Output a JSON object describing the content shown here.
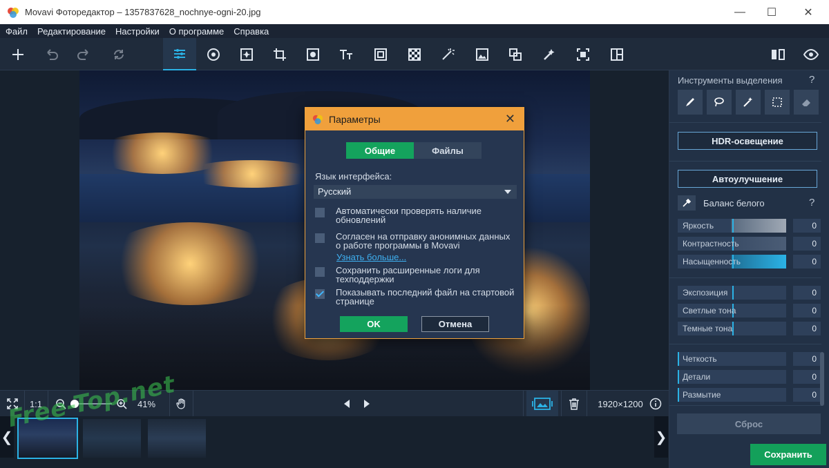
{
  "window": {
    "title": "Movavi Фоторедактор – 1357837628_nochnye-ogni-20.jpg",
    "controls": [
      "minimize",
      "maximize",
      "close"
    ]
  },
  "menu": [
    "Файл",
    "Редактирование",
    "Настройки",
    "О программе",
    "Справка"
  ],
  "toolbar": {
    "left_icons": [
      "add-icon",
      "undo-icon",
      "redo-icon",
      "reset-icon"
    ],
    "tools": [
      "adjust-icon",
      "retouch-icon",
      "effects-icon",
      "crop-icon",
      "objects-icon",
      "text-icon",
      "frame-icon",
      "background-icon",
      "magic-icon",
      "image-icon",
      "shapes-icon",
      "wand-icon",
      "select-icon",
      "split-icon"
    ],
    "right_icons": [
      "compare-icon",
      "preview-eye-icon"
    ]
  },
  "bottom": {
    "zoom_ratio": "1:1",
    "zoom_percent": "41%",
    "image_size": "1920×1200"
  },
  "watermark": "Free-Top.net",
  "right_panel": {
    "selection_title": "Инструменты выделения",
    "help": "?",
    "hdr_button": "HDR-освещение",
    "auto_button": "Автоулучшение",
    "white_balance": "Баланс белого",
    "sliders_group1": [
      {
        "label": "Яркость",
        "value": "0",
        "fill": 0.5
      },
      {
        "label": "Контрастность",
        "value": "0",
        "fill": 0.5
      },
      {
        "label": "Насыщенность",
        "value": "0",
        "fill": 0.5
      }
    ],
    "sliders_group2": [
      {
        "label": "Экспозиция",
        "value": "0",
        "fill": 0.5
      },
      {
        "label": "Светлые тона",
        "value": "0",
        "fill": 0.5
      },
      {
        "label": "Темные тона",
        "value": "0",
        "fill": 0.5
      }
    ],
    "sliders_group3": [
      {
        "label": "Четкость",
        "value": "0",
        "fill": 0.0
      },
      {
        "label": "Детали",
        "value": "0",
        "fill": 0.0
      },
      {
        "label": "Размытие",
        "value": "0",
        "fill": 0.0
      }
    ],
    "reset_button": "Сброс"
  },
  "save_button": "Сохранить",
  "dialog": {
    "title": "Параметры",
    "tabs": [
      "Общие",
      "Файлы"
    ],
    "language_label": "Язык интерфейса:",
    "language_value": "Русский",
    "options": [
      {
        "text": "Автоматически проверять наличие обновлений",
        "checked": false
      },
      {
        "text": "Согласен на отправку анонимных данных о работе программы в Movavi",
        "checked": false
      },
      {
        "text": "Сохранить расширенные логи для техподдержки",
        "checked": false
      },
      {
        "text": "Показывать последний файл на стартовой странице",
        "checked": true
      }
    ],
    "learn_more": "Узнать больше...",
    "ok": "OK",
    "cancel": "Отмена"
  },
  "colors": {
    "accent": "#2bb3e6",
    "green": "#13a05a",
    "dialog_header": "#f0a03c"
  }
}
